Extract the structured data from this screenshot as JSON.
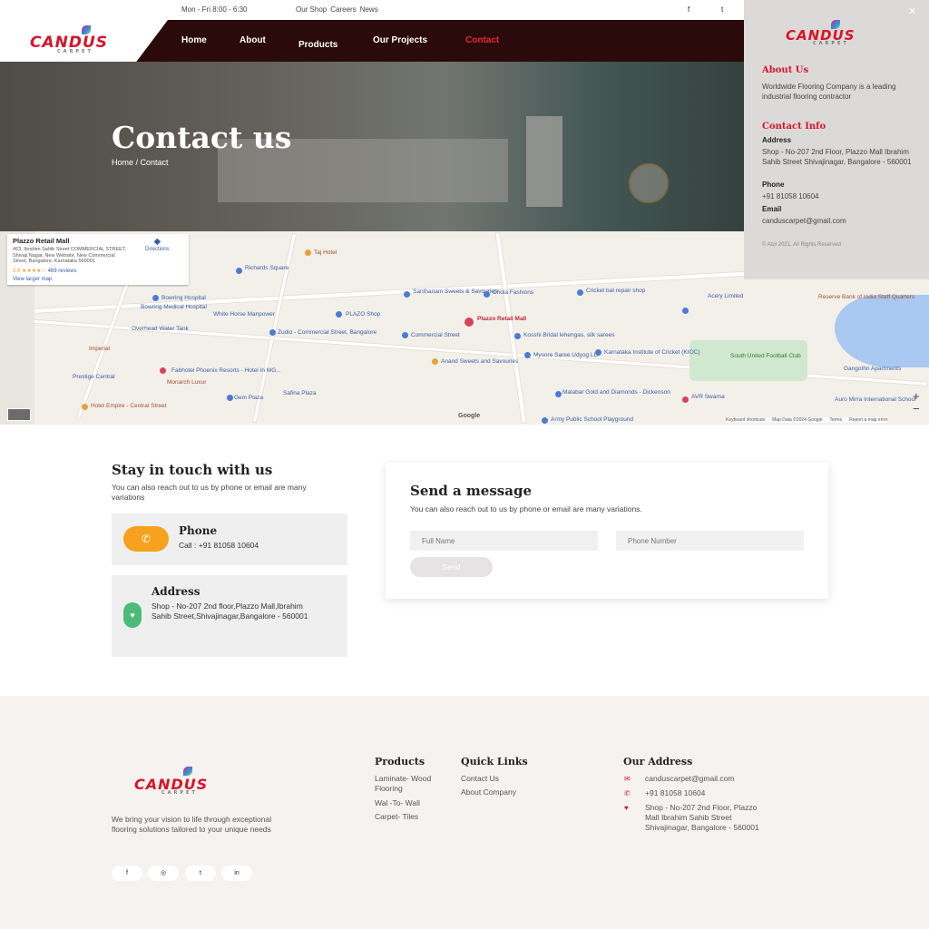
{
  "topbar": {
    "hours": "Mon - Fri 8:00 - 6:30",
    "links": [
      "Our Shop",
      "Careers",
      "News"
    ],
    "social": [
      "facebook-icon",
      "twitter-icon"
    ]
  },
  "nav": {
    "items": [
      "Home",
      "About",
      "Products",
      "Our Projects",
      "Contact"
    ],
    "active": "Contact"
  },
  "logo": {
    "text": "CANDUS",
    "sub": "CARPET"
  },
  "hero": {
    "title": "Contact us",
    "breadcrumb": "Home / Contact"
  },
  "map": {
    "card_title": "Plazzo Retail Mall",
    "card_address": "#63, Ibrahim Sahib Street COMMERCIAL STREET, Shivaji Nagar, New Website, New Commercial Street, Bangalore, Karnataka 560001",
    "card_rating": "3.9 ★★★★☆",
    "card_reviews": "469 reviews",
    "card_directions": "Directions",
    "card_larger": "View larger map",
    "labels": [
      "Richards Square",
      "Taj Hotel",
      "Santhanam Sweets & Savouries",
      "Chola Fashions",
      "PLAZO Shop",
      "Zudio - Commercial Street, Bangalore",
      "Commercial Street",
      "Plazzo Retail Mall",
      "Kosshi Bridal lehengas, silk sarees",
      "Mysore Saree Udyog LLP",
      "Anand Sweets and Savouries",
      "Karnataka Institute of Cricket (KIOC)",
      "Bowring Hospital",
      "Bowring Medical Hospital",
      "White Horse Manpower",
      "Overhead Water Tank",
      "Fabhotel Phoenix Resorts - Hotel In MG...",
      "Monarch Luxur",
      "Gem Plaza",
      "Safina Plaza",
      "Hotel Empire - Central Street",
      "Malabar Gold and Diamonds - Dickenson",
      "AVR Swarna",
      "South United Football Club",
      "Reserve Bank of India Staff Quarters",
      "Mysore Saree Udyog",
      "Army Public School Playground",
      "Auro Mirra International School",
      "Gangothri Apartments",
      "Cricket bat repair shop",
      "Acery Limited",
      "Prestige Central",
      "Imperial"
    ],
    "footer": [
      "Keyboard shortcuts",
      "Map Data ©2024 Google",
      "Terms",
      "Report a map error"
    ],
    "google": "Google",
    "zoom_in": "+",
    "zoom_out": "−"
  },
  "side": {
    "close": "✕",
    "about_h": "About Us",
    "about": "Worldwide Flooring Company is a leading industrial flooring contractor",
    "contact_h": "Contact Info",
    "address_l": "Address",
    "address": "Shop - No-207 2nd Floor, Plazzo Mall Ibrahim Sahib Street Shivajinagar, Bangalore - 560001",
    "phone_l": "Phone",
    "phone": "+91 81058 10604",
    "email_l": "Email",
    "email": "canduscarpet@gmail.com",
    "copy": "© Atul 2021. All Rights Reserved"
  },
  "stay": {
    "title": "Stay in touch with us",
    "sub": "You can also reach out to us by phone or email are many variations",
    "phone_h": "Phone",
    "phone_v": "Call : +91 81058 10604",
    "addr_h": "Address",
    "addr_v": "Shop - No-207 2nd floor,Plazzo Mall,Ibrahim Sahib Street,Shivajinagar,Bangalore - 560001"
  },
  "form": {
    "title": "Send a message",
    "sub": "You can also reach out to us by phone or email are many variations.",
    "name_ph": "Full Name",
    "phone_ph": "Phone Number",
    "send": "Send"
  },
  "footer": {
    "tagline": "We bring your vision to life through exceptional flooring solutions tailored to your unique needs",
    "products_h": "Products",
    "products": [
      "Laminate- Wood Flooring",
      "Wal -To- Wall",
      "Carpet- Tiles"
    ],
    "quick_h": "Quick Links",
    "quick": [
      "Contact Us",
      "About Company"
    ],
    "addr_h": "Our Address",
    "email": "canduscarpet@gmail.com",
    "phone": "+91 81058 10604",
    "address": "Shop - No-207 2nd Floor, Plazzo Mall Ibrahim Sahib Street Shivajinagar, Bangalore - 560001",
    "social": [
      "facebook-icon",
      "instagram-icon",
      "twitter-icon",
      "linkedin-icon"
    ]
  },
  "colors": {
    "brand": "#d8142a",
    "nav": "#2a0a0a",
    "phone_icon": "#f6a21e",
    "addr_icon": "#4cbb7a"
  }
}
